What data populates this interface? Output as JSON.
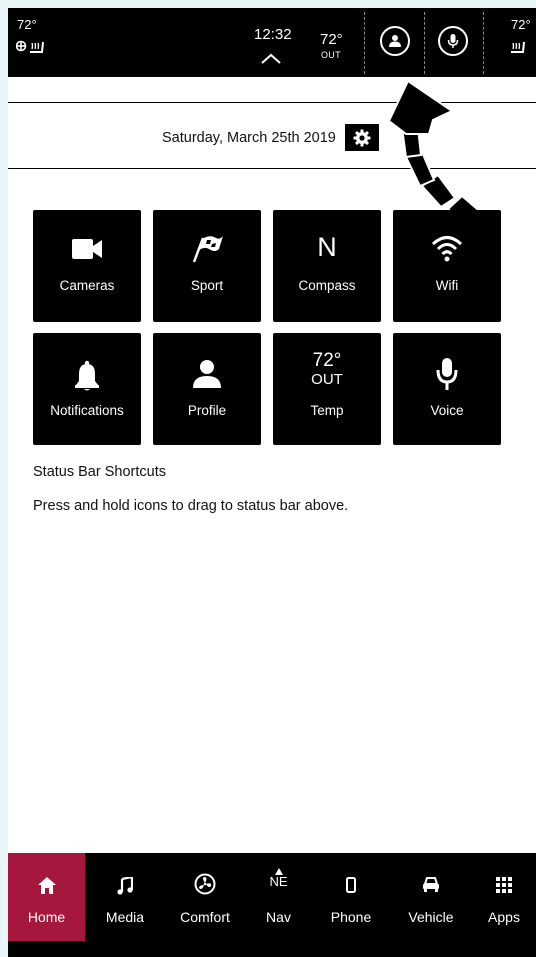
{
  "status_bar": {
    "left_temp": "72°",
    "time": "12:32",
    "outside_temp": "72°",
    "outside_label": "OUT",
    "right_temp": "72°"
  },
  "header": {
    "date": "Saturday, March 25th 2019"
  },
  "tiles": [
    {
      "label": "Cameras",
      "icon": "camera-icon"
    },
    {
      "label": "Sport",
      "icon": "flag-icon"
    },
    {
      "label": "Compass",
      "icon": "compass-icon",
      "glyph": "N"
    },
    {
      "label": "Wifi",
      "icon": "wifi-icon"
    },
    {
      "label": "Notifications",
      "icon": "bell-icon"
    },
    {
      "label": "Profile",
      "icon": "person-icon"
    },
    {
      "label": "Temp",
      "icon": "temperature-icon",
      "value": "72°",
      "sub": "OUT"
    },
    {
      "label": "Voice",
      "icon": "microphone-icon"
    }
  ],
  "instructions": {
    "title": "Status Bar Shortcuts",
    "description": "Press and hold icons to drag to status bar above."
  },
  "bottom_nav": {
    "items": [
      {
        "label": "Home",
        "icon": "home-icon",
        "active": true
      },
      {
        "label": "Media",
        "icon": "music-note-icon"
      },
      {
        "label": "Comfort",
        "icon": "fan-icon"
      },
      {
        "label": "Nav",
        "icon": "compass-arrow-icon",
        "heading": "NE"
      },
      {
        "label": "Phone",
        "icon": "phone-icon"
      },
      {
        "label": "Vehicle",
        "icon": "car-icon"
      },
      {
        "label": "Apps",
        "icon": "apps-grid-icon"
      }
    ]
  },
  "colors": {
    "active_tab": "#a6173d",
    "bar_background": "#000000",
    "page_border": "#e8f6f8"
  }
}
